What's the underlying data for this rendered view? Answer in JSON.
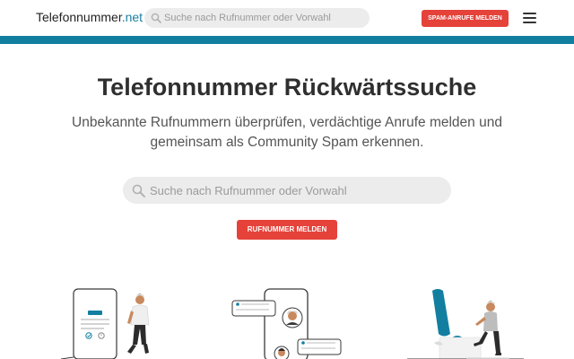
{
  "header": {
    "logo_name": "Telefonnummer",
    "logo_tld": ".net",
    "search_placeholder": "Suche nach Rufnummer oder Vorwahl",
    "spam_button": "SPAM-ANRUFE MELDEN",
    "icons": [
      "search-icon",
      "hamburger-menu-icon"
    ]
  },
  "theme": {
    "accent": "#127fa1",
    "button_red": "#e5423a",
    "search_bg": "#ececec"
  },
  "hero": {
    "title": "Telefonnummer Rückwärtssuche",
    "subtitle_line1": "Unbekannte Rufnummern überprüfen, verdächtige Anrufe melden und",
    "subtitle_line2": "gemeinsam als Community Spam erkennen.",
    "search_placeholder": "Suche nach Rufnummer oder Vorwahl",
    "report_button": "RUFNUMMER MELDEN"
  },
  "illustrations": [
    "phone-checklist-illustration",
    "phone-chat-illustration",
    "exclamation-warning-illustration"
  ]
}
